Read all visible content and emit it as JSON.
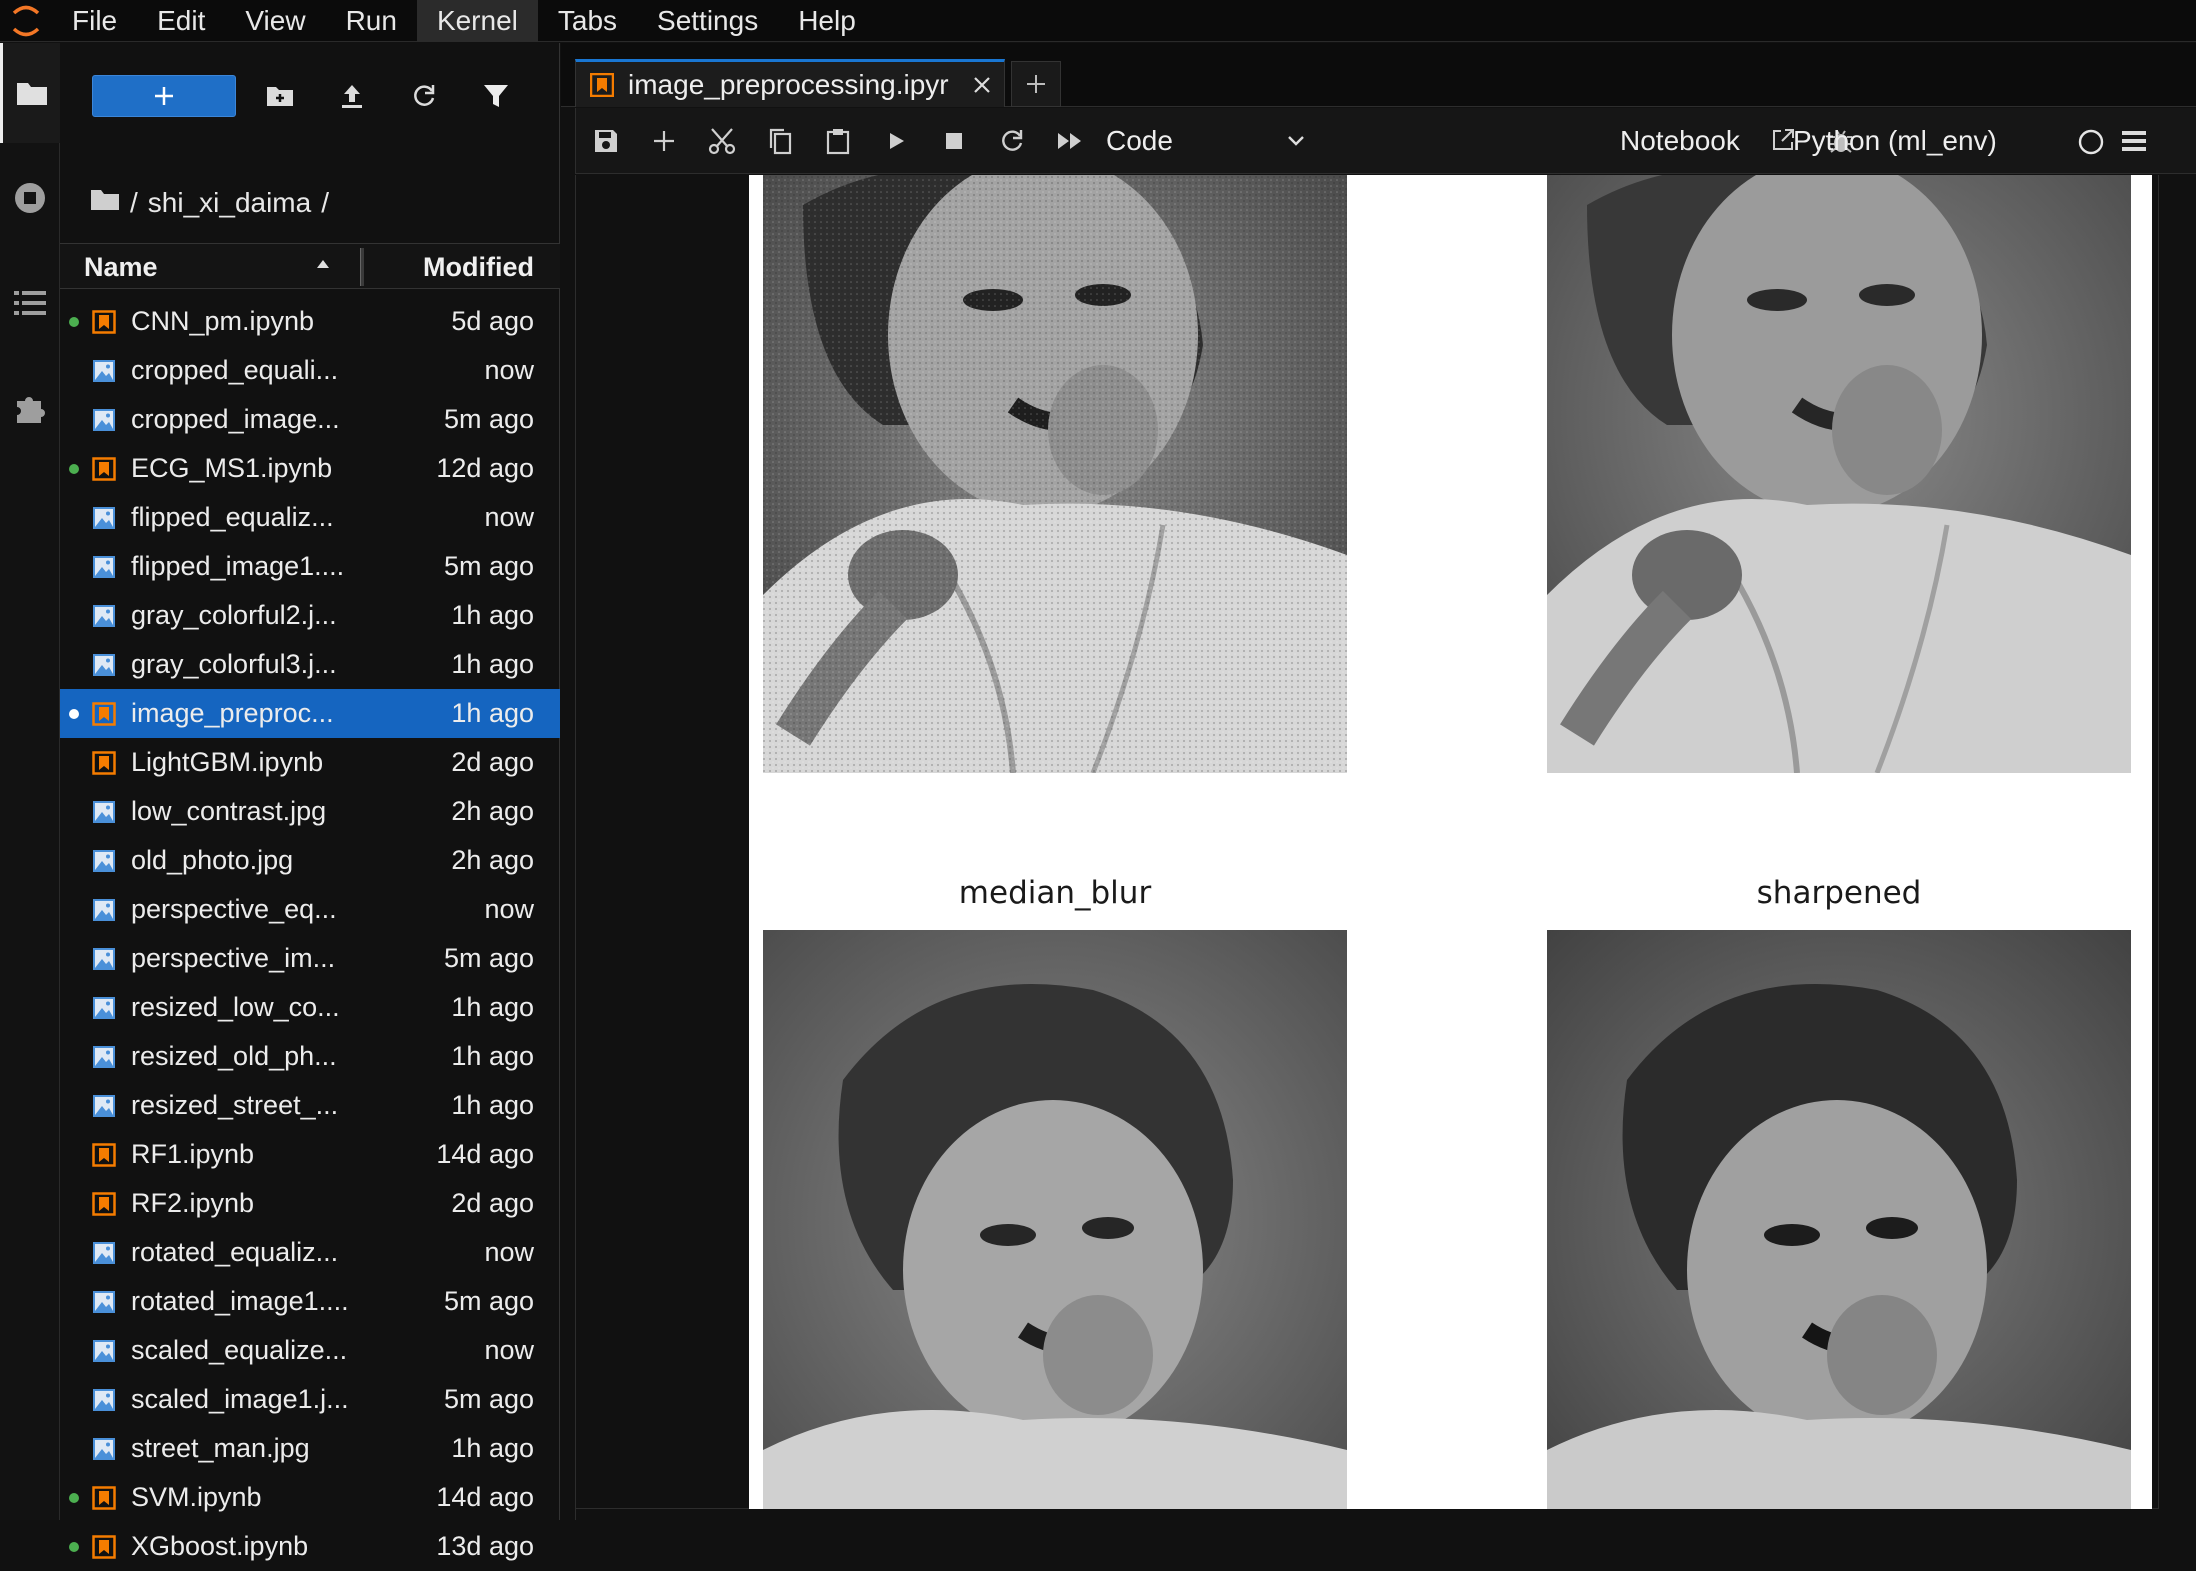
{
  "menubar": {
    "items": [
      "File",
      "Edit",
      "View",
      "Run",
      "Kernel",
      "Tabs",
      "Settings",
      "Help"
    ],
    "active": "Kernel"
  },
  "filebrowser": {
    "path_separator_start": "/",
    "folder": "shi_xi_daima",
    "path_separator_end": "/",
    "columns": {
      "name": "Name",
      "modified": "Modified"
    },
    "files": [
      {
        "name": "CNN_pm.ipynb",
        "modified": "5d ago",
        "type": "notebook",
        "running": true,
        "selected": false
      },
      {
        "name": "cropped_equali...",
        "modified": "now",
        "type": "image",
        "running": false,
        "selected": false
      },
      {
        "name": "cropped_image...",
        "modified": "5m ago",
        "type": "image",
        "running": false,
        "selected": false
      },
      {
        "name": "ECG_MS1.ipynb",
        "modified": "12d ago",
        "type": "notebook",
        "running": true,
        "selected": false
      },
      {
        "name": "flipped_equaliz...",
        "modified": "now",
        "type": "image",
        "running": false,
        "selected": false
      },
      {
        "name": "flipped_image1....",
        "modified": "5m ago",
        "type": "image",
        "running": false,
        "selected": false
      },
      {
        "name": "gray_colorful2.j...",
        "modified": "1h ago",
        "type": "image",
        "running": false,
        "selected": false
      },
      {
        "name": "gray_colorful3.j...",
        "modified": "1h ago",
        "type": "image",
        "running": false,
        "selected": false
      },
      {
        "name": "image_preproc...",
        "modified": "1h ago",
        "type": "notebook",
        "running": true,
        "selected": true
      },
      {
        "name": "LightGBM.ipynb",
        "modified": "2d ago",
        "type": "notebook",
        "running": false,
        "selected": false
      },
      {
        "name": "low_contrast.jpg",
        "modified": "2h ago",
        "type": "image",
        "running": false,
        "selected": false
      },
      {
        "name": "old_photo.jpg",
        "modified": "2h ago",
        "type": "image",
        "running": false,
        "selected": false
      },
      {
        "name": "perspective_eq...",
        "modified": "now",
        "type": "image",
        "running": false,
        "selected": false
      },
      {
        "name": "perspective_im...",
        "modified": "5m ago",
        "type": "image",
        "running": false,
        "selected": false
      },
      {
        "name": "resized_low_co...",
        "modified": "1h ago",
        "type": "image",
        "running": false,
        "selected": false
      },
      {
        "name": "resized_old_ph...",
        "modified": "1h ago",
        "type": "image",
        "running": false,
        "selected": false
      },
      {
        "name": "resized_street_...",
        "modified": "1h ago",
        "type": "image",
        "running": false,
        "selected": false
      },
      {
        "name": "RF1.ipynb",
        "modified": "14d ago",
        "type": "notebook",
        "running": false,
        "selected": false
      },
      {
        "name": "RF2.ipynb",
        "modified": "2d ago",
        "type": "notebook",
        "running": false,
        "selected": false
      },
      {
        "name": "rotated_equaliz...",
        "modified": "now",
        "type": "image",
        "running": false,
        "selected": false
      },
      {
        "name": "rotated_image1....",
        "modified": "5m ago",
        "type": "image",
        "running": false,
        "selected": false
      },
      {
        "name": "scaled_equalize...",
        "modified": "now",
        "type": "image",
        "running": false,
        "selected": false
      },
      {
        "name": "scaled_image1.j...",
        "modified": "5m ago",
        "type": "image",
        "running": false,
        "selected": false
      },
      {
        "name": "street_man.jpg",
        "modified": "1h ago",
        "type": "image",
        "running": false,
        "selected": false
      },
      {
        "name": "SVM.ipynb",
        "modified": "14d ago",
        "type": "notebook",
        "running": true,
        "selected": false
      },
      {
        "name": "XGboost.ipynb",
        "modified": "13d ago",
        "type": "notebook",
        "running": true,
        "selected": false
      }
    ]
  },
  "tabs": {
    "active_label": "image_preprocessing.ipyr"
  },
  "notebook_toolbar": {
    "cell_type": "Code",
    "notebook_label": "Notebook",
    "kernel": "Python (ml_env)"
  },
  "output": {
    "plot_titles": [
      "median_blur",
      "sharpened"
    ]
  },
  "colors": {
    "accent": "#1976d2",
    "selected_row": "#1565c0",
    "notebook_icon": "#f57c00",
    "image_icon": "#4a90d9",
    "running_dot": "#4caf50"
  },
  "icons": {
    "activity": [
      "folder-icon",
      "running-icon",
      "toc-icon",
      "extension-icon"
    ],
    "filebrowser_toolbar": [
      "plus-icon",
      "new-folder-icon",
      "upload-icon",
      "refresh-icon",
      "filter-icon"
    ],
    "notebook_toolbar": [
      "save-icon",
      "insert-cell-icon",
      "cut-icon",
      "copy-icon",
      "paste-icon",
      "run-icon",
      "stop-icon",
      "restart-icon",
      "fast-forward-icon",
      "external-link-icon",
      "bug-icon",
      "kernel-status-icon",
      "menu-icon"
    ]
  }
}
